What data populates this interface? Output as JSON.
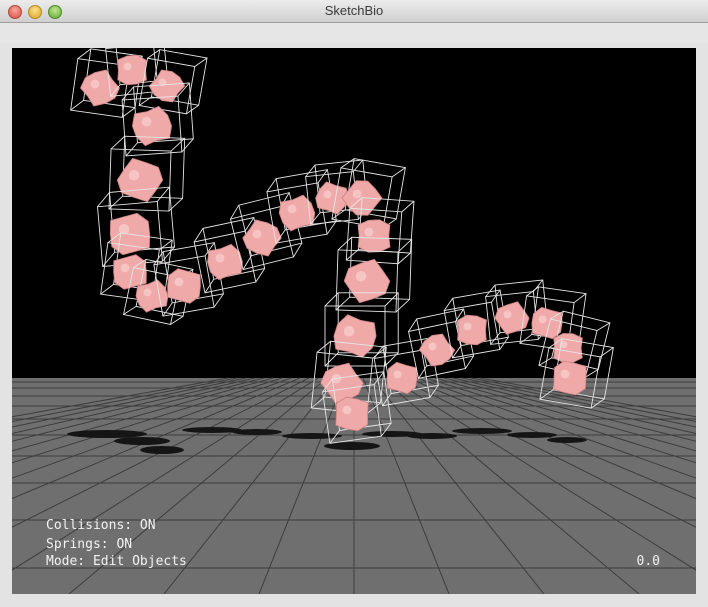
{
  "window": {
    "title": "SketchBio"
  },
  "hud": {
    "collisions": "Collisions: ON",
    "springs": "Springs: ON",
    "mode": "Mode: Edit Objects",
    "time": "0.0"
  },
  "colors": {
    "background": "#000000",
    "floor": "#6f6f6f",
    "grid": "#3a3a3a",
    "molecule": "#f0a9a9",
    "box_outline": "#e6e6e6"
  }
}
